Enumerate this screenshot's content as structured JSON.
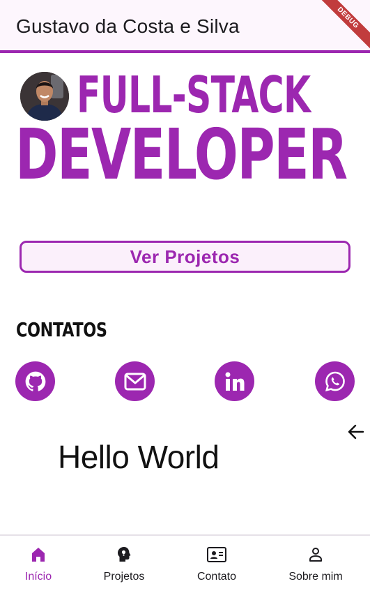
{
  "appbar": {
    "title": "Gustavo da Costa e Silva",
    "debug_label": "DEBUG"
  },
  "hero": {
    "line1": "FULL-STACK",
    "line2": "DEVELOPER"
  },
  "cta": {
    "label": "Ver Projetos"
  },
  "contacts": {
    "title": "CONTATOS",
    "items": [
      {
        "icon": "github-icon"
      },
      {
        "icon": "mail-icon"
      },
      {
        "icon": "linkedin-icon"
      },
      {
        "icon": "whatsapp-icon"
      }
    ]
  },
  "content": {
    "text": "Hello World"
  },
  "bottom_nav": {
    "items": [
      {
        "label": "Início",
        "icon": "home-icon",
        "active": true
      },
      {
        "label": "Projetos",
        "icon": "idea-head-icon",
        "active": false
      },
      {
        "label": "Contato",
        "icon": "contact-card-icon",
        "active": false
      },
      {
        "label": "Sobre mim",
        "icon": "person-icon",
        "active": false
      }
    ]
  },
  "colors": {
    "accent": "#9c27b0",
    "appbar_bg": "#fdf6fd",
    "text": "#1c1b1f"
  }
}
